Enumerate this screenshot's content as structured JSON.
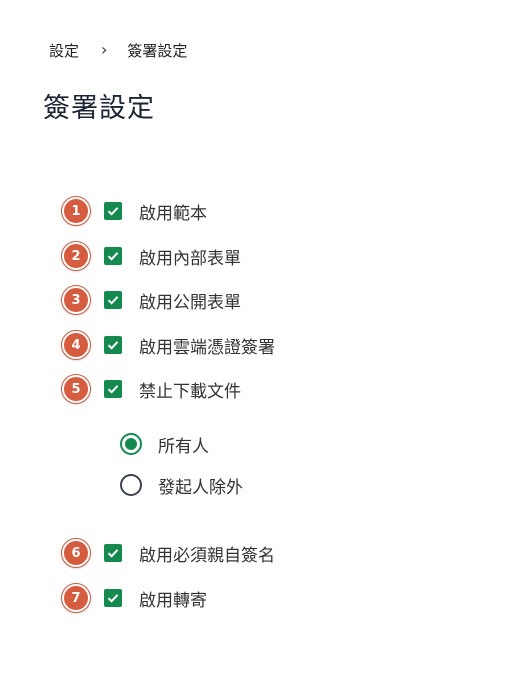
{
  "breadcrumb": {
    "parent": "設定",
    "separator": "›",
    "current": "簽署設定"
  },
  "page_title": "簽署設定",
  "colors": {
    "accent_green": "#158a4f",
    "badge_red": "#d55c3f",
    "title": "#1d2433"
  },
  "options": [
    {
      "badge": "1",
      "label": "啟用範本",
      "checked": true
    },
    {
      "badge": "2",
      "label": "啟用內部表單",
      "checked": true
    },
    {
      "badge": "3",
      "label": "啟用公開表單",
      "checked": true
    },
    {
      "badge": "4",
      "label": "啟用雲端憑證簽署",
      "checked": true
    },
    {
      "badge": "5",
      "label": "禁止下載文件",
      "checked": true
    },
    {
      "badge": "6",
      "label": "啟用必須親自簽名",
      "checked": true
    },
    {
      "badge": "7",
      "label": "啟用轉寄",
      "checked": true
    }
  ],
  "download_scope": {
    "options": [
      {
        "label": "所有人",
        "selected": true
      },
      {
        "label": "發起人除外",
        "selected": false
      }
    ]
  }
}
